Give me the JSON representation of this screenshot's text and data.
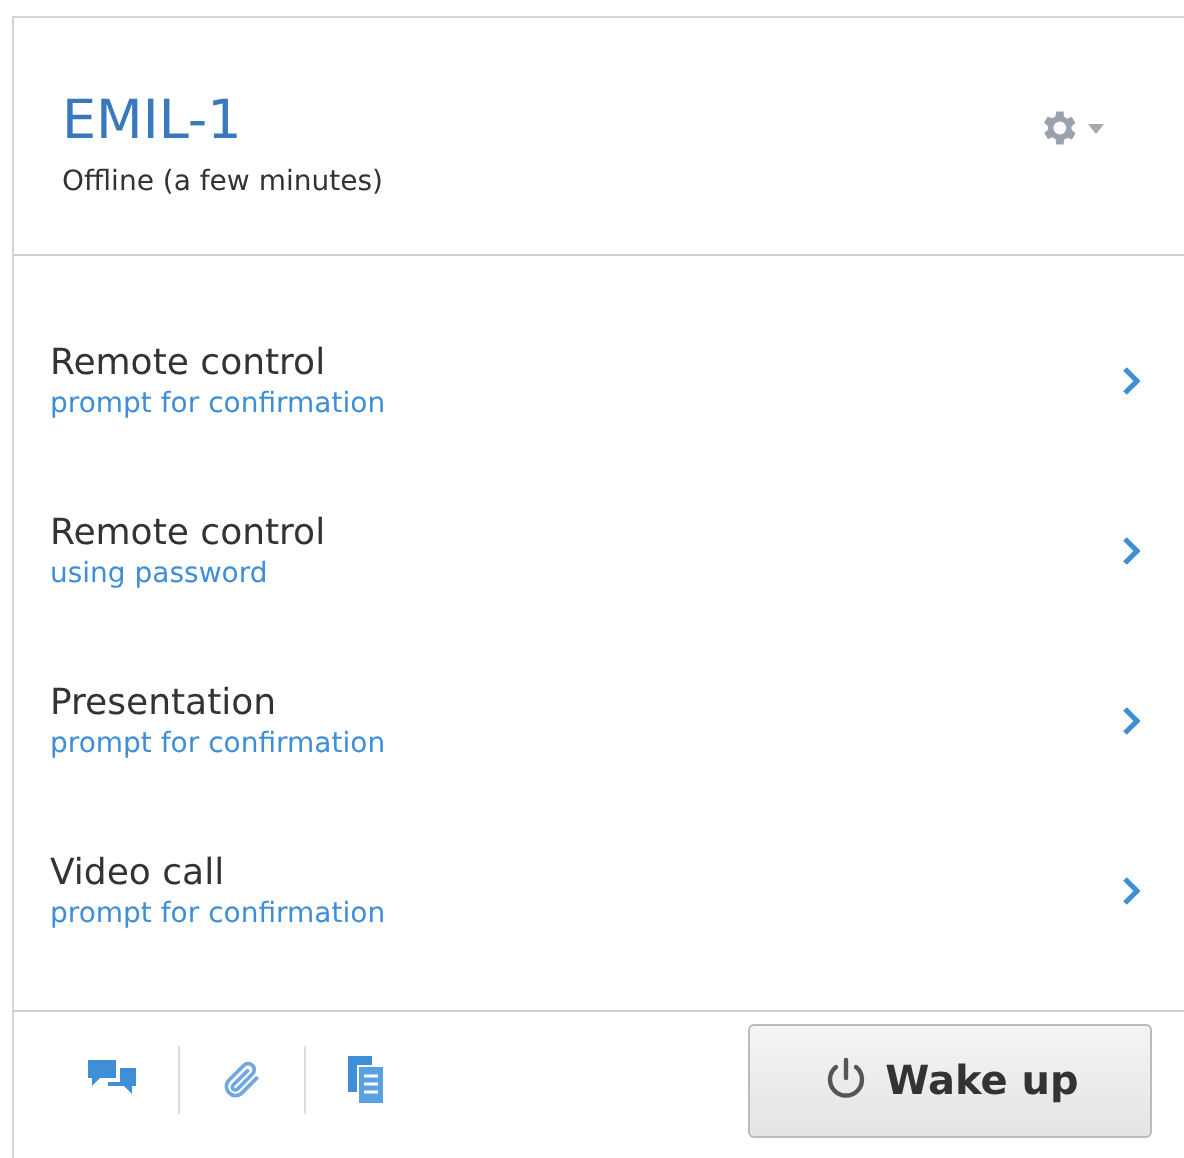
{
  "device": {
    "name": "EMIL-1",
    "status": "Offline (a few minutes)"
  },
  "actions": [
    {
      "title": "Remote control",
      "subtitle": "prompt for confirmation"
    },
    {
      "title": "Remote control",
      "subtitle": "using password"
    },
    {
      "title": "Presentation",
      "subtitle": "prompt for confirmation"
    },
    {
      "title": "Video call",
      "subtitle": "prompt for confirmation"
    }
  ],
  "wake_button": {
    "label": "Wake up"
  }
}
